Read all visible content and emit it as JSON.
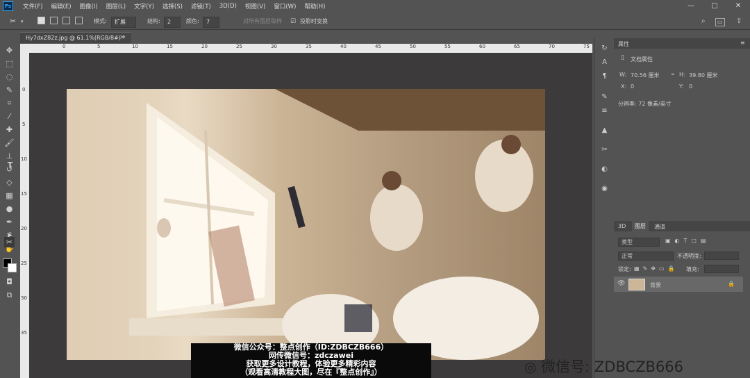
{
  "app": {
    "logo": "Ps"
  },
  "menu": [
    "文件(F)",
    "编辑(E)",
    "图像(I)",
    "图层(L)",
    "文字(Y)",
    "选择(S)",
    "滤镜(T)",
    "3D(D)",
    "视图(V)",
    "窗口(W)",
    "帮助(H)"
  ],
  "window_controls": {
    "minimize": "—",
    "maximize": "□",
    "close": "✕"
  },
  "options": {
    "mode_label": "模式:",
    "mode_value": "扩展",
    "struct_label": "结构:",
    "struct_value": "2",
    "color_label": "颜色:",
    "color_value": "7",
    "sample_all": "对所有图层取样",
    "transform_label": "投影时变换",
    "transform_checked": true
  },
  "document": {
    "tab_title": "Hy7dxZ82z.jpg @ 61.1%(RGB/8#) *",
    "close": "×"
  },
  "rulers": {
    "h": [
      "0",
      "5",
      "10",
      "15",
      "20",
      "25",
      "30",
      "35",
      "40",
      "45",
      "50",
      "55",
      "60",
      "65",
      "70",
      "75"
    ],
    "v": [
      "0",
      "5",
      "10",
      "15",
      "20",
      "25",
      "30",
      "35"
    ]
  },
  "properties": {
    "title": "属性",
    "doc_section": "文档属性",
    "w_label": "W:",
    "w_value": "70.56 厘米",
    "h_label": "H:",
    "h_value": "39.80 厘米",
    "x_label": "X:",
    "x_value": "0",
    "y_label": "Y:",
    "y_value": "0",
    "resolution": "分辨率: 72 像素/英寸"
  },
  "layers": {
    "tabs": [
      "3D",
      "图层",
      "通道"
    ],
    "filter": "类型",
    "blend": "正常",
    "opacity_label": "不透明度:",
    "lock_label": "锁定:",
    "fill_label": "填充:",
    "layer_name": "背景"
  },
  "caption": {
    "line1": "微信公众号：整点创作（ID:ZDBCZB666）",
    "line2": "网传微信号：zdczawei",
    "line3": "获取更多设计教程，体验更多精彩内容",
    "line4": "（观看高清教程大图，尽在『整点创作』）"
  },
  "watermark": "微信号: ZDBCZB666",
  "colors": {
    "ui_bg": "#535353",
    "panel_dark": "#454545",
    "pasteboard": "#3c3a3b",
    "accent": "#31a8ff"
  }
}
